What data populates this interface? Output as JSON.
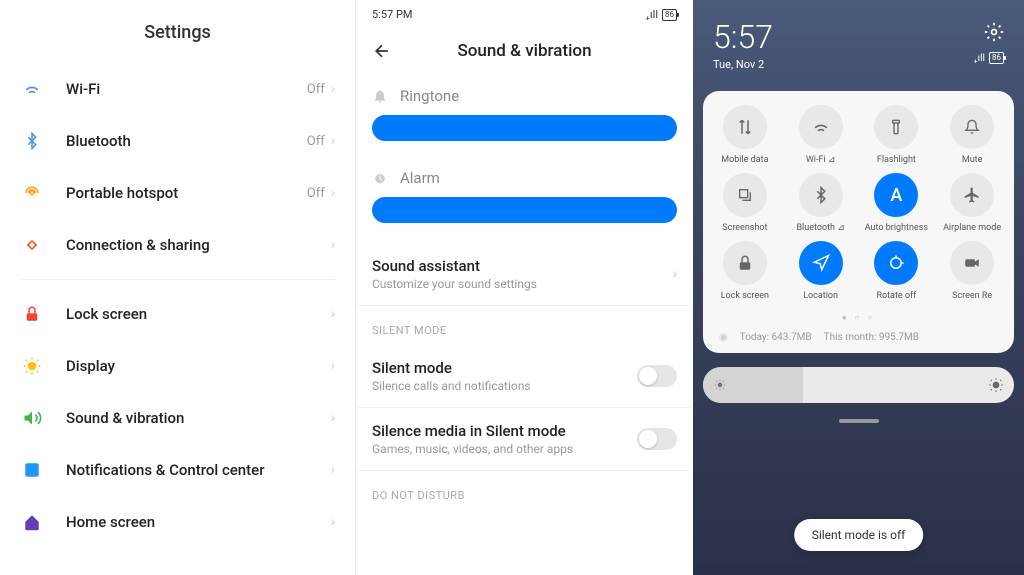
{
  "panel1": {
    "title": "Settings",
    "items": [
      {
        "label": "Wi-Fi",
        "value": "Off",
        "icon": "wifi",
        "color": "#4a90e2"
      },
      {
        "label": "Bluetooth",
        "value": "Off",
        "icon": "bluetooth",
        "color": "#4a90e2"
      },
      {
        "label": "Portable hotspot",
        "value": "Off",
        "icon": "hotspot",
        "color": "#f5a623"
      },
      {
        "label": "Connection & sharing",
        "value": "",
        "icon": "share",
        "color": "#ff5722"
      }
    ],
    "items2": [
      {
        "label": "Lock screen",
        "icon": "lock",
        "color": "#f44336"
      },
      {
        "label": "Display",
        "icon": "display",
        "color": "#ffc107"
      },
      {
        "label": "Sound & vibration",
        "icon": "sound",
        "color": "#4caf50"
      },
      {
        "label": "Notifications & Control center",
        "icon": "notif",
        "color": "#2196f3"
      },
      {
        "label": "Home screen",
        "icon": "home",
        "color": "#673ab7"
      }
    ]
  },
  "panel2": {
    "time": "5:57 PM",
    "battery": "86",
    "title": "Sound & vibration",
    "ringtone": "Ringtone",
    "alarm": "Alarm",
    "assistant_title": "Sound assistant",
    "assistant_sub": "Customize your sound settings",
    "silent_header": "SILENT MODE",
    "silent_title": "Silent mode",
    "silent_sub": "Silence calls and notifications",
    "media_title": "Silence media in Silent mode",
    "media_sub": "Games, music, videos, and other apps",
    "dnd_header": "DO NOT DISTURB"
  },
  "panel3": {
    "time": "5:57",
    "date": "Tue, Nov 2",
    "battery": "86",
    "tiles": [
      {
        "label": "Mobile data",
        "icon": "data",
        "active": false
      },
      {
        "label": "Wi-Fi ⊿",
        "icon": "wifi",
        "active": false
      },
      {
        "label": "Flashlight",
        "icon": "flash",
        "active": false
      },
      {
        "label": "Mute",
        "icon": "mute",
        "active": false
      },
      {
        "label": "Screenshot",
        "icon": "screenshot",
        "active": false
      },
      {
        "label": "Bluetooth ⊿",
        "icon": "bluetooth",
        "active": false
      },
      {
        "label": "Auto brightness",
        "icon": "bright",
        "active": true
      },
      {
        "label": "Airplane mode",
        "icon": "airplane",
        "active": false
      },
      {
        "label": "Lock screen",
        "icon": "lock",
        "active": false
      },
      {
        "label": "Location",
        "icon": "location",
        "active": true
      },
      {
        "label": "Rotate off",
        "icon": "rotate",
        "active": true
      },
      {
        "label": "Screen Re",
        "icon": "record",
        "active": false
      }
    ],
    "usage_today": "Today: 643.7MB",
    "usage_month": "This month: 995.7MB",
    "toast": "Silent mode is off"
  }
}
